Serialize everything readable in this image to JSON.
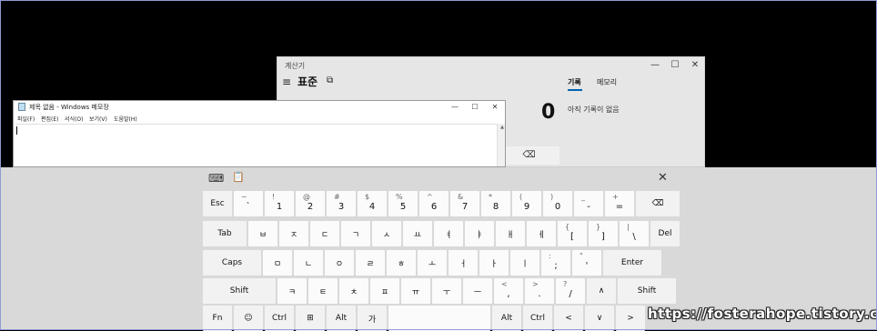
{
  "calculator": {
    "title": "계산기",
    "mode": "표준",
    "display": "0",
    "tab_history": "기록",
    "tab_memory": "메모리",
    "history_empty": "아직 기록이 없음",
    "minimize": "—",
    "maximize": "☐",
    "close": "✕",
    "hamburger": "≡",
    "keep_on_top": "⧉",
    "backspace": "⌫"
  },
  "notepad": {
    "title": "제목 없음 - Windows 메모장",
    "menu": [
      "파일(F)",
      "편집(E)",
      "서식(O)",
      "보기(V)",
      "도움말(H)"
    ],
    "minimize": "—",
    "maximize": "☐",
    "close": "✕"
  },
  "keyboard": {
    "toolbar": {
      "settings_icon": "⌨",
      "clipboard_icon": "📋",
      "close": "✕"
    },
    "rows": [
      [
        {
          "main": "Esc",
          "fn": true
        },
        {
          "main": "`",
          "shift": "~"
        },
        {
          "main": "1",
          "shift": "!"
        },
        {
          "main": "2",
          "shift": "@"
        },
        {
          "main": "3",
          "shift": "#"
        },
        {
          "main": "4",
          "shift": "$"
        },
        {
          "main": "5",
          "shift": "%"
        },
        {
          "main": "6",
          "shift": "^"
        },
        {
          "main": "7",
          "shift": "&"
        },
        {
          "main": "8",
          "shift": "*"
        },
        {
          "main": "9",
          "shift": "("
        },
        {
          "main": "0",
          "shift": ")"
        },
        {
          "main": "-",
          "shift": "_"
        },
        {
          "main": "=",
          "shift": "+"
        },
        {
          "main": "⌫",
          "fn": true
        }
      ],
      [
        {
          "main": "Tab",
          "fn": true
        },
        {
          "main": "ㅂ"
        },
        {
          "main": "ㅈ"
        },
        {
          "main": "ㄷ"
        },
        {
          "main": "ㄱ"
        },
        {
          "main": "ㅅ"
        },
        {
          "main": "ㅛ"
        },
        {
          "main": "ㅕ"
        },
        {
          "main": "ㅑ"
        },
        {
          "main": "ㅐ"
        },
        {
          "main": "ㅔ"
        },
        {
          "main": "[",
          "shift": "{"
        },
        {
          "main": "]",
          "shift": "}"
        },
        {
          "main": "\\",
          "shift": "|"
        },
        {
          "main": "Del",
          "fn": true
        }
      ],
      [
        {
          "main": "Caps",
          "fn": true
        },
        {
          "main": "ㅁ"
        },
        {
          "main": "ㄴ"
        },
        {
          "main": "ㅇ"
        },
        {
          "main": "ㄹ"
        },
        {
          "main": "ㅎ"
        },
        {
          "main": "ㅗ"
        },
        {
          "main": "ㅓ"
        },
        {
          "main": "ㅏ"
        },
        {
          "main": "ㅣ"
        },
        {
          "main": ";",
          "shift": ":"
        },
        {
          "main": "'",
          "shift": "\""
        },
        {
          "main": "Enter",
          "fn": true
        }
      ],
      [
        {
          "main": "Shift",
          "fn": true
        },
        {
          "main": "ㅋ"
        },
        {
          "main": "ㅌ"
        },
        {
          "main": "ㅊ"
        },
        {
          "main": "ㅍ"
        },
        {
          "main": "ㅠ"
        },
        {
          "main": "ㅜ"
        },
        {
          "main": "ㅡ"
        },
        {
          "main": ",",
          "shift": "<"
        },
        {
          "main": ".",
          "shift": ">"
        },
        {
          "main": "/",
          "shift": "?"
        },
        {
          "main": "∧",
          "fn": true
        },
        {
          "main": "Shift",
          "fn": true
        }
      ],
      [
        {
          "main": "Fn",
          "fn": true
        },
        {
          "main": "☺",
          "fn": true
        },
        {
          "main": "Ctrl",
          "fn": true
        },
        {
          "main": "⊞",
          "fn": true
        },
        {
          "main": "Alt",
          "fn": true
        },
        {
          "main": "가",
          "fn": true
        },
        {
          "main": "",
          "fn": false
        },
        {
          "main": "Alt",
          "fn": true
        },
        {
          "main": "Ctrl",
          "fn": true
        },
        {
          "main": "<",
          "fn": true
        },
        {
          "main": "∨",
          "fn": true
        },
        {
          "main": ">",
          "fn": true
        }
      ]
    ]
  },
  "watermark": "https://fosterahope.tistory.com"
}
